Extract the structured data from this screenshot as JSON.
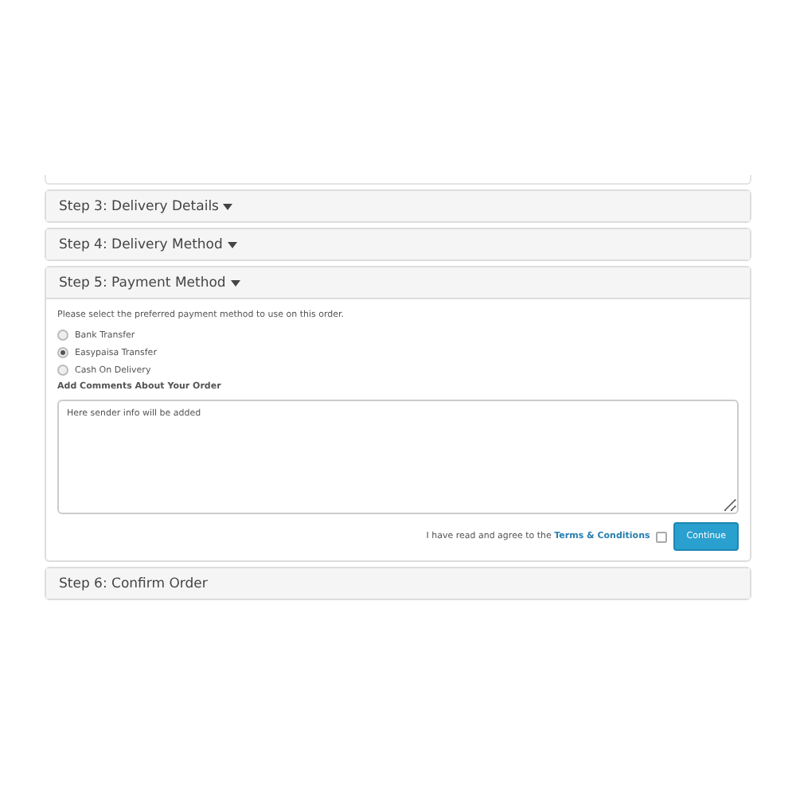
{
  "steps": [
    {
      "title": "Step 3: Delivery Details",
      "caret": true,
      "expanded": false
    },
    {
      "title": "Step 4: Delivery Method",
      "caret": true,
      "expanded": false
    },
    {
      "title": "Step 5: Payment Method",
      "caret": true,
      "expanded": true
    },
    {
      "title": "Step 6: Confirm Order",
      "caret": false,
      "expanded": false
    }
  ],
  "payment": {
    "intro": "Please select the preferred payment method to use on this order.",
    "methods": [
      {
        "label": "Bank Transfer",
        "selected": false
      },
      {
        "label": "Easypaisa Transfer",
        "selected": true
      },
      {
        "label": "Cash On Delivery",
        "selected": false
      }
    ],
    "comments_label": "Add Comments About Your Order",
    "comments_value": "Here sender info will be added",
    "agree_text": "I have read and agree to the ",
    "terms_link": "Terms & Conditions",
    "agree_checked": false,
    "continue_button": "Continue"
  }
}
